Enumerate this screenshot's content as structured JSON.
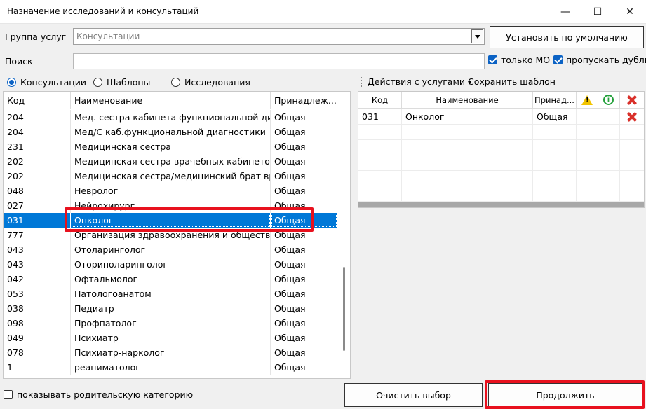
{
  "window": {
    "title": "Назначение исследований и консультаций",
    "minimize_glyph": "—",
    "maximize_glyph": "☐",
    "close_glyph": "✕"
  },
  "service_group": {
    "label": "Группа услуг",
    "value": "Консультации"
  },
  "set_default_button": "Установить по умолчанию",
  "search": {
    "label": "Поиск",
    "value": ""
  },
  "only_mo": {
    "label": "только МО",
    "checked": true
  },
  "skip_duplicates": {
    "label": "пропускать дубли",
    "checked": true
  },
  "mode_radios": [
    {
      "label": "Консультации",
      "selected": true
    },
    {
      "label": "Шаблоны",
      "selected": false
    },
    {
      "label": "Исследования",
      "selected": false
    }
  ],
  "left_table": {
    "headers": [
      "Код",
      "Наименование",
      "Принадлеж..."
    ],
    "rows": [
      {
        "code": "204",
        "name": "Мед. сестра кабинета функциональной диаг...",
        "owner": "Общая"
      },
      {
        "code": "204",
        "name": "Мед/С каб.функциональной диагностики",
        "owner": "Общая"
      },
      {
        "code": "231",
        "name": "Медицинская сестра",
        "owner": "Общая"
      },
      {
        "code": "202",
        "name": "Медицинская сестра врачебных кабинетов",
        "owner": "Общая"
      },
      {
        "code": "202",
        "name": "Медицинская сестра/медицинский брат вра...",
        "owner": "Общая"
      },
      {
        "code": "048",
        "name": "Невролог",
        "owner": "Общая"
      },
      {
        "code": "027",
        "name": "Нейрохирург",
        "owner": "Общая"
      },
      {
        "code": "031",
        "name": "Онколог",
        "owner": "Общая"
      },
      {
        "code": "777",
        "name": "Организация здравоохранения и обществе...",
        "owner": "Общая"
      },
      {
        "code": "043",
        "name": "Отоларинголог",
        "owner": "Общая"
      },
      {
        "code": "043",
        "name": "Оториноларинголог",
        "owner": "Общая"
      },
      {
        "code": "042",
        "name": "Офтальмолог",
        "owner": "Общая"
      },
      {
        "code": "053",
        "name": "Патологоанатом",
        "owner": "Общая"
      },
      {
        "code": "038",
        "name": "Педиатр",
        "owner": "Общая"
      },
      {
        "code": "098",
        "name": "Профпатолог",
        "owner": "Общая"
      },
      {
        "code": "049",
        "name": "Психиатр",
        "owner": "Общая"
      },
      {
        "code": "078",
        "name": "Психиатр-нарколог",
        "owner": "Общая"
      },
      {
        "code": "1",
        "name": "реаниматолог",
        "owner": "Общая"
      }
    ],
    "selected_index": 7
  },
  "right_toolbar": {
    "actions_label": "Действия с услугами",
    "actions_arrow": "▾",
    "save_template_label": "Сохранить шаблон"
  },
  "right_table": {
    "headers": [
      "Код",
      "Наименование",
      "Принад..."
    ],
    "header_icons": [
      "warning-icon",
      "info-icon",
      "delete-icon"
    ],
    "warning_glyph": "!",
    "info_glyph": "i",
    "rows": [
      {
        "code": "031",
        "name": "Онколог",
        "owner": "Общая"
      }
    ]
  },
  "show_parent": {
    "label": "показывать родительскую категорию",
    "checked": false
  },
  "clear_button": "Очистить выбор",
  "continue_button": "Продолжить",
  "colors": {
    "selection": "#0078d7",
    "highlight": "#e8111e",
    "accent": "#0b62c4"
  }
}
